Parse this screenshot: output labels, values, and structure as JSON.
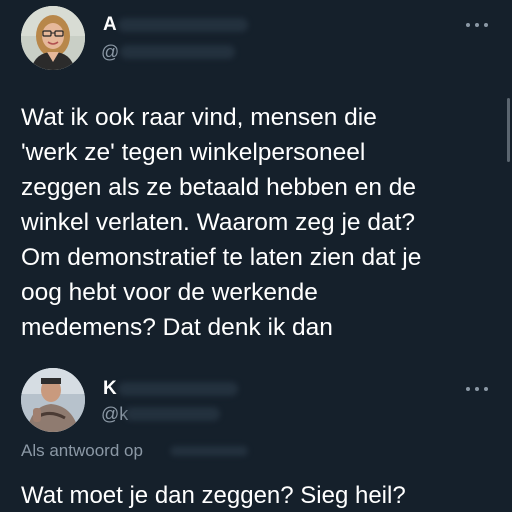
{
  "main_tweet": {
    "display_name": "A",
    "handle": "@",
    "text": "Wat ik ook raar vind, mensen die\n'werk ze' tegen winkelpersoneel\nzeggen als ze betaald hebben en de\nwinkel verlaten. Waarom zeg je dat?\nOm demonstratief  te laten zien dat je\noog hebt voor de werkende\nmedemens?  Dat denk ik dan",
    "more_icon": "more-horizontal-icon"
  },
  "reply_tweet": {
    "display_name": "K",
    "handle": "@k",
    "reply_to_label": "Als antwoord op",
    "reply_to_handle": "",
    "text": "Wat moet je dan zeggen? Sieg heil?",
    "more_icon": "more-horizontal-icon"
  },
  "colors": {
    "background": "#15202b",
    "primary_text": "#ffffff",
    "secondary_text": "#8b98a5"
  }
}
